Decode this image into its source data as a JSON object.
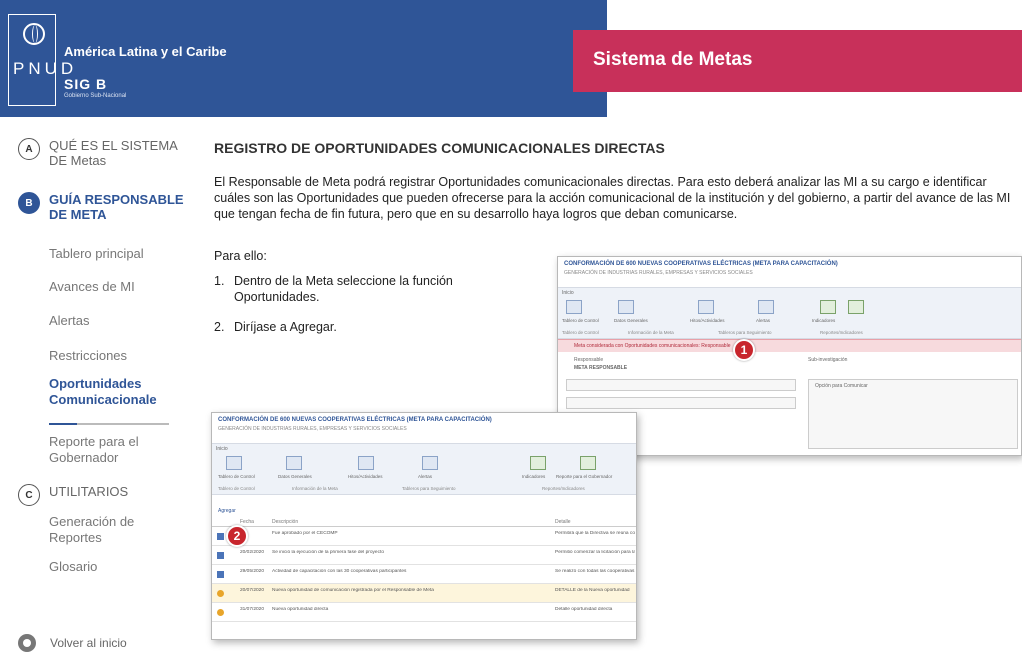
{
  "header": {
    "region_title": "América Latina y el Caribe",
    "org_letters": "PNUD",
    "brand": "SIG B",
    "brand_sub": "Gobierno Sub-Nacional",
    "app_title": "Sistema de Metas",
    "colors": {
      "header_blue": "#2f5597",
      "title_magenta": "#c8305a"
    }
  },
  "sidebar": {
    "sections": [
      {
        "letter": "A",
        "label": "QUÉ ES EL SISTEMA DE Metas"
      },
      {
        "letter": "B",
        "label": "GUÍA RESPONSABLE DE META"
      },
      {
        "letter": "C",
        "label": "UTILITARIOS"
      }
    ],
    "items_b": [
      {
        "label": "Tablero principal"
      },
      {
        "label": "Avances de MI"
      },
      {
        "label": "Alertas"
      },
      {
        "label": "Restricciones"
      },
      {
        "label": "Oportunidades Comunicacionale"
      },
      {
        "label": "Reporte para el Gobernador"
      }
    ],
    "items_c": [
      {
        "label": "Generación de Reportes"
      },
      {
        "label": "Glosario"
      }
    ],
    "home_label": "Volver al inicio"
  },
  "main": {
    "title": "REGISTRO DE OPORTUNIDADES COMUNICACIONALES DIRECTAS",
    "intro": "El Responsable de Meta podrá registrar Oportunidades comunicacionales directas. Para esto deberá analizar las MI a su cargo e identificar cuáles son las Oportunidades que pueden ofrecerse para la acción comunicacional de la institución y del gobierno, a partir del avance de las MI que tengan fecha de fin futura, pero que en su desarrollo haya logros que deban comunicarse.",
    "para": "Para ello:",
    "steps": [
      {
        "num": "1.",
        "text": "Dentro de la Meta seleccione la función Oportunidades."
      },
      {
        "num": "2.",
        "text": "Diríjase a Agregar."
      }
    ]
  },
  "screenshot1": {
    "title": "CONFORMACIÓN DE 600 NUEVAS COOPERATIVAS ELÉCTRICAS (META PARA CAPACITACIÓN)",
    "subtitle": "GENERACIÓN DE INDUSTRIAS RURALES, EMPRESAS Y SERVICIOS SOCIALES",
    "tab": "Inicio",
    "ribbon_buttons": [
      "Tablero de Control",
      "Datos Generales",
      "Hitos/Actividades",
      "Alertas",
      "Indicadores",
      "Reporte para el Gobernador"
    ],
    "ribbon_groups": [
      "Tablero de Control",
      "Información de la Meta",
      "Tableros para Seguimiento",
      "Reportes/Indicadores"
    ],
    "alert": "Meta considerada con Oportunidades comunicacionales: Responsable",
    "responsable_label": "Responsable",
    "responsable_value": "META RESPONSABLE",
    "sub_label": "Sub-investigación",
    "panel_title": "Opción para Comunicar",
    "callout": "1"
  },
  "screenshot2": {
    "title": "CONFORMACIÓN DE 600 NUEVAS COOPERATIVAS ELÉCTRICAS (META PARA CAPACITACIÓN)",
    "subtitle": "GENERACIÓN DE INDUSTRIAS RURALES, EMPRESAS Y SERVICIOS SOCIALES",
    "tab": "Inicio",
    "ribbon_buttons": [
      "Tablero de Control",
      "Datos Generales",
      "Hitos/Actividades",
      "Alertas",
      "Indicadores",
      "Reporte para el Gobernador"
    ],
    "ribbon_groups": [
      "Tablero de Control",
      "Información de la Meta",
      "Tableros para Seguimiento",
      "Reportes/Indicadores"
    ],
    "add_label": "Agregar",
    "columns": [
      "Fecha",
      "Descripción",
      "Detalle"
    ],
    "rows": [
      {
        "date": "",
        "desc": "Fue aprobado por el CECOMP",
        "detail": "Permitirá que la Directiva se reúna con Chuqui Condorendo",
        "warn": false
      },
      {
        "date": "20/02/2020",
        "desc": "Se inició la ejecución de la primera fase del proyecto",
        "detail": "Permitió comenzar la licitación para la obra",
        "warn": false
      },
      {
        "date": "29/05/2020",
        "desc": "Actividad de capacitación con las 30 cooperativas participantes",
        "detail": "Se realizó con todas las cooperativas eléctricas",
        "warn": false
      },
      {
        "date": "20/07/2020",
        "desc": "Nueva oportunidad de comunicación registrada por el Responsable de Meta",
        "detail": "DETALLE de la Nueva oportunidad",
        "warn": true
      },
      {
        "date": "31/07/2020",
        "desc": "Nueva oportunidad directa",
        "detail": "Detalle oportunidad directa",
        "warn": true
      }
    ],
    "callout": "2"
  }
}
